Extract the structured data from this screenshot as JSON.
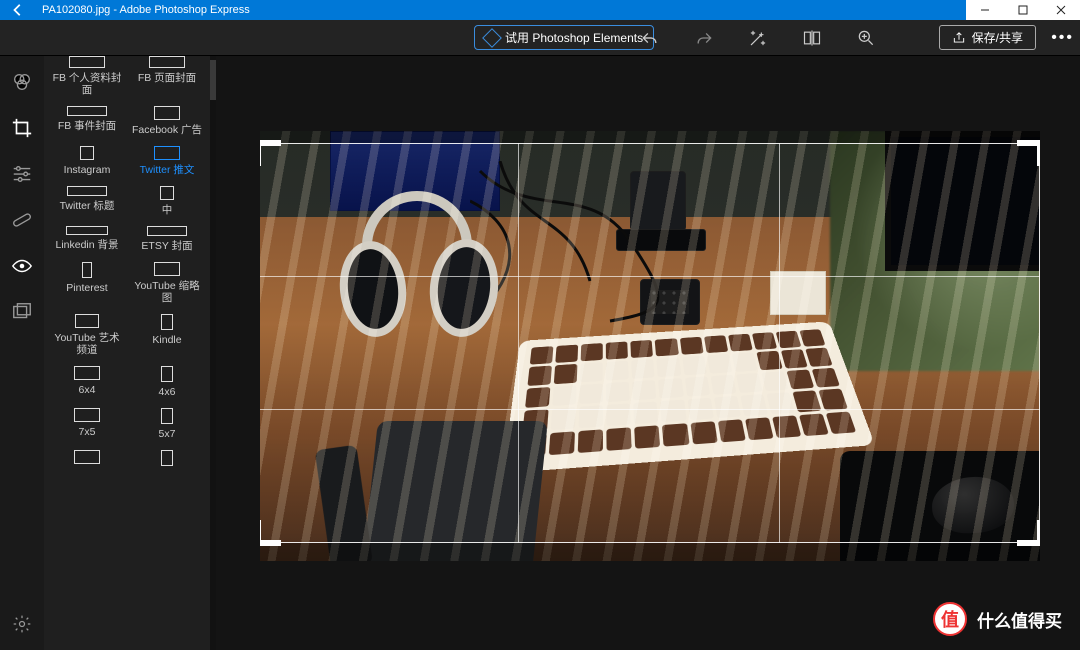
{
  "window": {
    "filename": "PA102080.jpg",
    "app": "Adobe Photoshop Express",
    "title_sep": " - "
  },
  "toolbar": {
    "elements_promo": "试用 Photoshop Elements",
    "save_share": "保存/共享",
    "icons": {
      "undo": "undo-icon",
      "redo": "redo-icon",
      "auto": "auto-enhance-icon",
      "compare": "compare-icon",
      "zoom": "zoom-icon",
      "share": "share-icon",
      "more": "more-icon"
    }
  },
  "rail": {
    "items": [
      {
        "name": "looks-icon"
      },
      {
        "name": "crop-icon"
      },
      {
        "name": "adjust-icon"
      },
      {
        "name": "heal-icon"
      },
      {
        "name": "redeye-icon"
      },
      {
        "name": "border-icon"
      }
    ],
    "active_index": 1,
    "settings": "settings-icon"
  },
  "presets": {
    "items": [
      {
        "label": "FB 个人资料封面",
        "shape": "sh-wide"
      },
      {
        "label": "FB 页面封面",
        "shape": "sh-wide"
      },
      {
        "label": "FB 事件封面",
        "shape": "sh-strip"
      },
      {
        "label": "Facebook 广告",
        "shape": "sh-rect"
      },
      {
        "label": "Instagram",
        "shape": "sh-sq"
      },
      {
        "label": "Twitter 推文",
        "shape": "sh-rect",
        "selected": true
      },
      {
        "label": "Twitter 标题",
        "shape": "sh-strip"
      },
      {
        "label": "中",
        "shape": "sh-sq"
      },
      {
        "label": "Linkedin 背景",
        "shape": "sh-banner"
      },
      {
        "label": "ETSY 封面",
        "shape": "sh-strip"
      },
      {
        "label": "Pinterest",
        "shape": "sh-tall"
      },
      {
        "label": "YouTube 缩略图",
        "shape": "sh-rect"
      },
      {
        "label": "YouTube 艺术频道",
        "shape": "sh-tv"
      },
      {
        "label": "Kindle",
        "shape": "sh-tallw"
      },
      {
        "label": "6x4",
        "shape": "sh-rect"
      },
      {
        "label": "4x6",
        "shape": "sh-tallw"
      },
      {
        "label": "7x5",
        "shape": "sh-rect"
      },
      {
        "label": "5x7",
        "shape": "sh-tallw"
      },
      {
        "label": "",
        "shape": "sh-rect"
      },
      {
        "label": "",
        "shape": "sh-tallw"
      }
    ]
  },
  "watermark": {
    "badge": "值",
    "text": "什么值得买"
  }
}
